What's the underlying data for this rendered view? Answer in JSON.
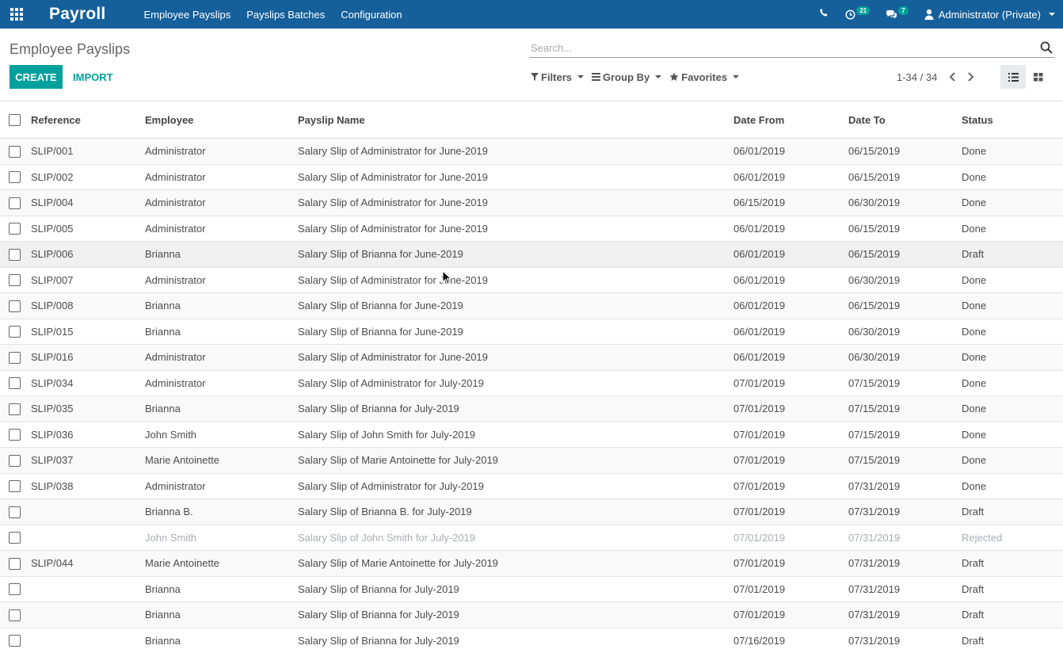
{
  "navbar": {
    "brand": "Payroll",
    "menu": [
      "Employee Payslips",
      "Payslips Batches",
      "Configuration"
    ],
    "activity_count": "21",
    "message_count": "7",
    "user": "Administrator (Private)"
  },
  "control": {
    "title": "Employee Payslips",
    "search_placeholder": "Search...",
    "create_label": "CREATE",
    "import_label": "IMPORT",
    "filters_label": "Filters",
    "groupby_label": "Group By",
    "favorites_label": "Favorites",
    "pager": "1-34 / 34"
  },
  "table": {
    "columns": [
      "Reference",
      "Employee",
      "Payslip Name",
      "Date From",
      "Date To",
      "Status"
    ],
    "rows": [
      [
        "SLIP/001",
        "Administrator",
        "Salary Slip of Administrator for June-2019",
        "06/01/2019",
        "06/15/2019",
        "Done"
      ],
      [
        "SLIP/002",
        "Administrator",
        "Salary Slip of Administrator for June-2019",
        "06/01/2019",
        "06/15/2019",
        "Done"
      ],
      [
        "SLIP/004",
        "Administrator",
        "Salary Slip of Administrator for June-2019",
        "06/15/2019",
        "06/30/2019",
        "Done"
      ],
      [
        "SLIP/005",
        "Administrator",
        "Salary Slip of Administrator for June-2019",
        "06/01/2019",
        "06/15/2019",
        "Done"
      ],
      [
        "SLIP/006",
        "Brianna",
        "Salary Slip of Brianna for June-2019",
        "06/01/2019",
        "06/15/2019",
        "Draft"
      ],
      [
        "SLIP/007",
        "Administrator",
        "Salary Slip of Administrator for June-2019",
        "06/01/2019",
        "06/30/2019",
        "Done"
      ],
      [
        "SLIP/008",
        "Brianna",
        "Salary Slip of Brianna for June-2019",
        "06/01/2019",
        "06/15/2019",
        "Done"
      ],
      [
        "SLIP/015",
        "Brianna",
        "Salary Slip of Brianna for June-2019",
        "06/01/2019",
        "06/30/2019",
        "Done"
      ],
      [
        "SLIP/016",
        "Administrator",
        "Salary Slip of Administrator for June-2019",
        "06/01/2019",
        "06/30/2019",
        "Done"
      ],
      [
        "SLIP/034",
        "Administrator",
        "Salary Slip of Administrator for July-2019",
        "07/01/2019",
        "07/15/2019",
        "Done"
      ],
      [
        "SLIP/035",
        "Brianna",
        "Salary Slip of Brianna for July-2019",
        "07/01/2019",
        "07/15/2019",
        "Done"
      ],
      [
        "SLIP/036",
        "John Smith",
        "Salary Slip of John Smith for July-2019",
        "07/01/2019",
        "07/15/2019",
        "Done"
      ],
      [
        "SLIP/037",
        "Marie Antoinette",
        "Salary Slip of Marie Antoinette for July-2019",
        "07/01/2019",
        "07/15/2019",
        "Done"
      ],
      [
        "SLIP/038",
        "Administrator",
        "Salary Slip of Administrator for July-2019",
        "07/01/2019",
        "07/31/2019",
        "Done"
      ],
      [
        "",
        "Brianna B.",
        "Salary Slip of Brianna B. for July-2019",
        "07/01/2019",
        "07/31/2019",
        "Draft"
      ],
      [
        "",
        "John Smith",
        "Salary Slip of John Smith for July-2019",
        "07/01/2019",
        "07/31/2019",
        "Rejected"
      ],
      [
        "SLIP/044",
        "Marie Antoinette",
        "Salary Slip of Marie Antoinette for July-2019",
        "07/01/2019",
        "07/31/2019",
        "Draft"
      ],
      [
        "",
        "Brianna",
        "Salary Slip of Brianna for July-2019",
        "07/01/2019",
        "07/31/2019",
        "Draft"
      ],
      [
        "",
        "Brianna",
        "Salary Slip of Brianna for July-2019",
        "07/01/2019",
        "07/31/2019",
        "Draft"
      ],
      [
        "",
        "Brianna",
        "Salary Slip of Brianna for July-2019",
        "07/16/2019",
        "07/31/2019",
        "Draft"
      ]
    ]
  }
}
